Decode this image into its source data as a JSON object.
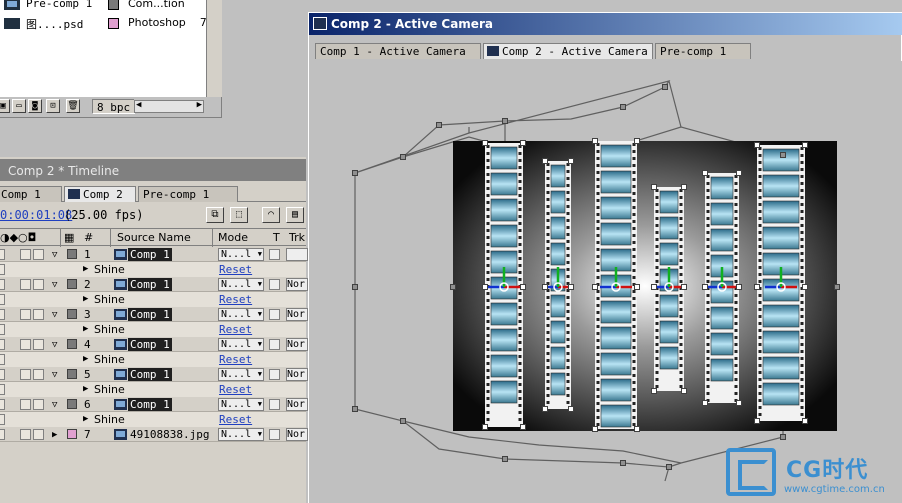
{
  "project": {
    "items": [
      {
        "name": "Pre-comp 1",
        "type": "Com...tion",
        "color": "#7a7a7a",
        "icon": "comp-icon"
      },
      {
        "name": "图....psd",
        "type": "Photoshop",
        "color": "#e0a0d0",
        "icon": "psd-icon"
      }
    ],
    "trailing_char": "7",
    "bpc_label": "8 bpc"
  },
  "timeline": {
    "title": "Comp 2 * Timeline",
    "tabs": [
      "Comp 1",
      "Comp 2",
      "Pre-comp 1"
    ],
    "active_tab": "Comp 2",
    "timecode": "0:00:01:08",
    "fps": "(25.00 fps)",
    "columns": {
      "hash": "#",
      "source_name": "Source Name",
      "mode": "Mode",
      "t": "T",
      "trk": "Trk"
    },
    "layers": [
      {
        "num": "1",
        "source": "Comp 1",
        "mode": "N...l",
        "trk": "",
        "effect": "Shine",
        "reset": "Reset Options..."
      },
      {
        "num": "2",
        "source": "Comp 1",
        "mode": "N...l",
        "trk": "Nor",
        "effect": "Shine",
        "reset": "Reset Options..."
      },
      {
        "num": "3",
        "source": "Comp 1",
        "mode": "N...l",
        "trk": "Nor",
        "effect": "Shine",
        "reset": "Reset Options..."
      },
      {
        "num": "4",
        "source": "Comp 1",
        "mode": "N...l",
        "trk": "Nor",
        "effect": "Shine",
        "reset": "Reset Options..."
      },
      {
        "num": "5",
        "source": "Comp 1",
        "mode": "N...l",
        "trk": "Nor",
        "effect": "Shine",
        "reset": "Reset Options..."
      },
      {
        "num": "6",
        "source": "Comp 1",
        "mode": "N...l",
        "trk": "Nor",
        "effect": "Shine",
        "reset": "Reset Options..."
      },
      {
        "num": "7",
        "source": "49108838.jpg",
        "mode": "N...l",
        "trk": "Nor"
      }
    ]
  },
  "comp": {
    "title": "Comp 2 - Active Camera",
    "tabs": [
      "Comp 1 - Active Camera",
      "Comp 2 - Active Camera",
      "Pre-comp 1"
    ],
    "active_tab": "Comp 2 - Active Camera"
  },
  "watermark": {
    "brand": "CG时代",
    "url": "www.cgtime.com.cn",
    "color": "#3b8fd0"
  }
}
